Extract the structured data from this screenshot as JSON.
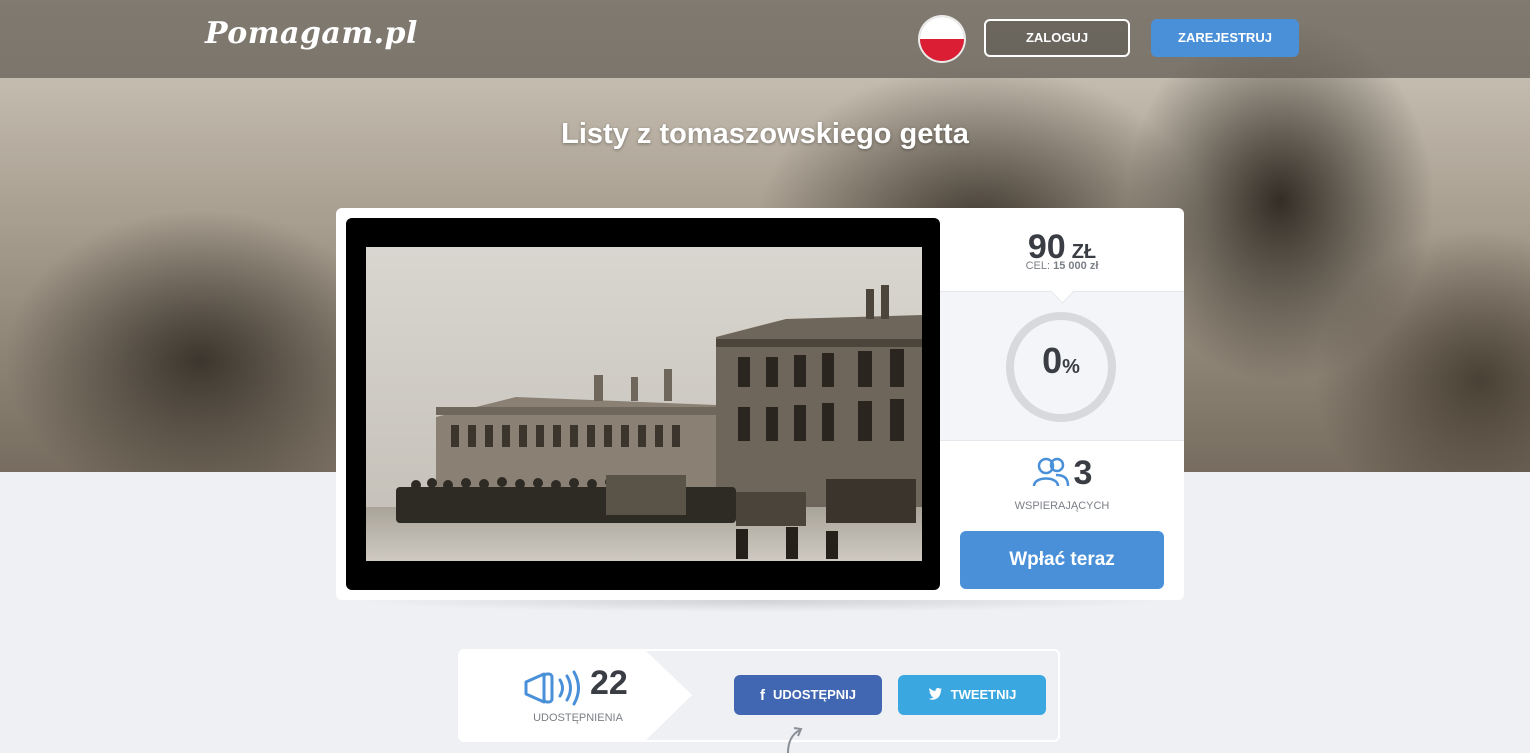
{
  "header": {
    "logo": "Pomagam.pl",
    "language_flag_icon": "poland-flag-icon",
    "login_label": "ZALOGUJ",
    "register_label": "ZAREJESTRUJ"
  },
  "campaign": {
    "title": "Listy z tomaszowskiego getta",
    "video_thumbnail": "photo of a ruined building with people and trucks in front"
  },
  "stats": {
    "amount": "90",
    "currency": "ZŁ",
    "goal_label": "CEL:",
    "goal_value": "15 000 zł",
    "progress_value": "0",
    "progress_symbol": "%",
    "progress_fraction": 0,
    "supporters_icon": "people-icon",
    "supporters_count": "3",
    "supporters_label": "WSPIERAJĄCYCH",
    "donate_label": "Wpłać teraz"
  },
  "share": {
    "icon": "megaphone-icon",
    "count": "22",
    "label": "UDOSTĘPNIENIA",
    "facebook_label": "UDOSTĘPNIJ",
    "twitter_label": "TWEETNIJ"
  },
  "colors": {
    "accent": "#4a90d9",
    "facebook": "#4267b2",
    "twitter": "#3aa7e0",
    "text_dark": "#3a3d44",
    "page_bg": "#eef0f4"
  }
}
